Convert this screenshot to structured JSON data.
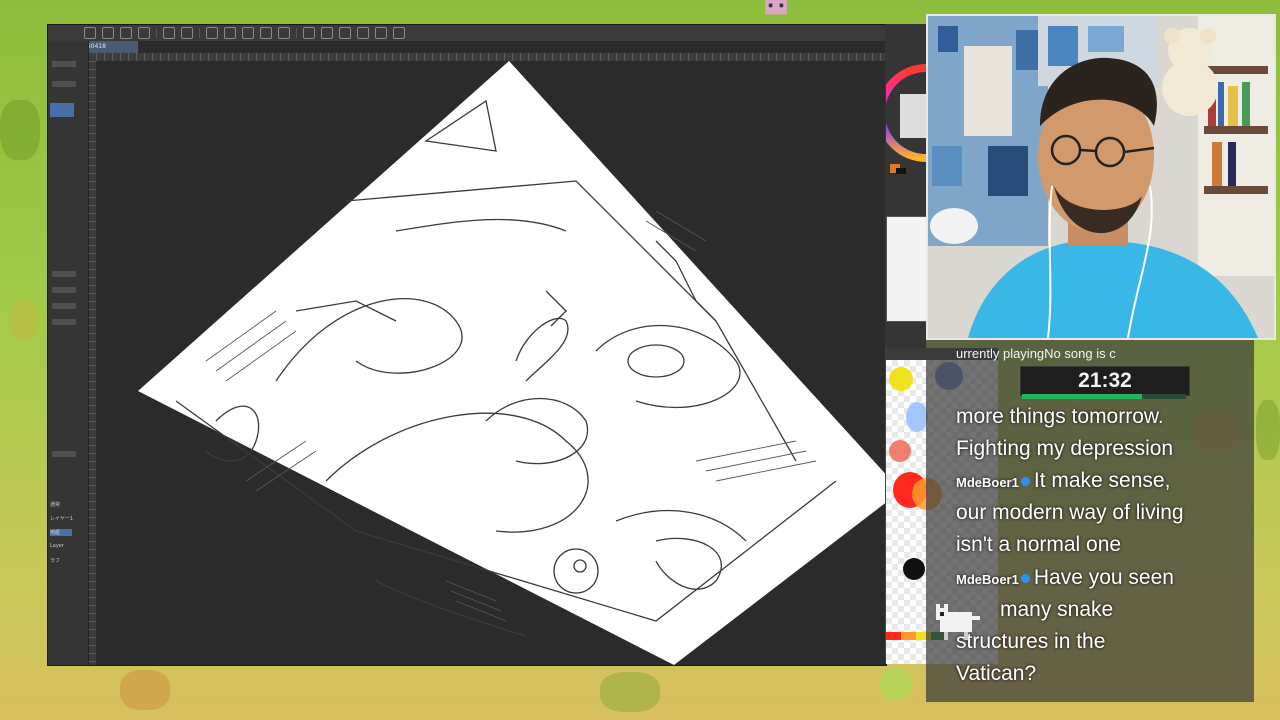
{
  "app": {
    "document_tab": "260418",
    "left_panel_labels": [
      "通常",
      "レイヤー1",
      "用紙",
      "Layer",
      "ラフ"
    ]
  },
  "overlay": {
    "now_playing": "urrently playingNo song is c",
    "timer": "21:32",
    "timer_progress": 0.73
  },
  "chat": {
    "messages": [
      {
        "user": "",
        "text_lines": [
          "more things tomorrow.",
          "Fighting my depression"
        ]
      },
      {
        "user": "MdeBoer1",
        "text_lines": [
          "It make sense,",
          "our modern way of living",
          "isn't a normal one"
        ]
      },
      {
        "user": "MdeBoer1",
        "text_lines": [
          "Have you seen",
          "many snake",
          "structures in the",
          "Vatican?"
        ]
      }
    ]
  },
  "swatches": [
    "#f2e21c",
    "#6f8fd6",
    "#f07f6f",
    "#ff2a1e",
    "#ff9a2a",
    "#111111",
    "#a3c6ff",
    "#2a8b3a"
  ],
  "colors": {
    "accent": "#4a6ea8",
    "timer_bar": "#25b35b",
    "user_badge": "#2f8ff2"
  }
}
